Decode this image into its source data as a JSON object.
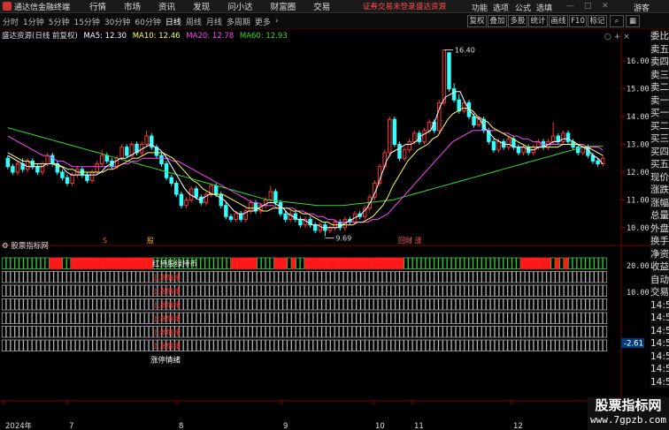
{
  "app": {
    "title": "通达信金融终端",
    "menus": [
      "行情",
      "市场",
      "资讯",
      "发现",
      "问小达",
      "财富圈",
      "交易"
    ],
    "notice": "证券交易未登录",
    "notice2": "盛达资源",
    "right_menus": [
      "功能",
      "选项",
      "公式",
      "选填",
      "游客"
    ]
  },
  "toolbar": {
    "periods": [
      "分时",
      "1分钟",
      "5分钟",
      "15分钟",
      "30分钟",
      "60分钟",
      "日线",
      "周线",
      "月线",
      "多周期",
      "更多"
    ],
    "active_period": "日线",
    "tools": [
      "复权",
      "叠加",
      "多股",
      "统计",
      "画线",
      "F10",
      "标记"
    ]
  },
  "info": {
    "stock": "盛达资源(日线 前复权)",
    "ma5": "MA5: 12.30",
    "ma10": "MA10: 12.46",
    "ma20": "MA20: 12.78",
    "ma60": "MA60: 12.93"
  },
  "colors": {
    "up": "#ff3333",
    "down": "#33ffff",
    "ma5": "#ffffff",
    "ma10": "#ffff66",
    "ma20": "#ff44ff",
    "ma60": "#33dd33",
    "grid": "#550000"
  },
  "chart_data": {
    "type": "candlestick",
    "title": "盛达资源(日线 前复权)",
    "y_ticks": [
      10.0,
      11.0,
      12.0,
      13.0,
      14.0,
      15.0,
      16.0
    ],
    "ylim": [
      9.55,
      16.8
    ],
    "x_labels": [
      "2024年",
      "7",
      "8",
      "9",
      "10",
      "11",
      "12"
    ],
    "max_label": "16.40",
    "min_label": "9.69",
    "event_labels": [
      "S",
      "股",
      "回财 涨"
    ],
    "candles": [
      [
        12.5,
        12.2,
        12.6,
        12.1
      ],
      [
        12.2,
        12.0,
        12.3,
        11.9
      ],
      [
        12.0,
        12.3,
        12.4,
        11.9
      ],
      [
        12.3,
        12.1,
        12.5,
        12.0
      ],
      [
        12.1,
        12.4,
        12.5,
        12.0
      ],
      [
        12.4,
        12.2,
        12.5,
        12.1
      ],
      [
        12.2,
        12.0,
        12.3,
        11.9
      ],
      [
        12.0,
        12.3,
        12.4,
        11.9
      ],
      [
        12.3,
        12.6,
        12.7,
        12.2
      ],
      [
        12.6,
        12.3,
        12.7,
        12.2
      ],
      [
        12.3,
        12.0,
        12.4,
        11.9
      ],
      [
        12.0,
        11.8,
        12.1,
        11.7
      ],
      [
        11.8,
        11.6,
        11.9,
        11.5
      ],
      [
        11.6,
        11.9,
        12.0,
        11.5
      ],
      [
        11.9,
        12.1,
        12.2,
        11.8
      ],
      [
        12.1,
        11.9,
        12.2,
        11.8
      ],
      [
        11.9,
        11.7,
        12.0,
        11.6
      ],
      [
        11.7,
        12.0,
        12.1,
        11.6
      ],
      [
        12.0,
        12.3,
        12.4,
        11.9
      ],
      [
        12.3,
        12.6,
        12.8,
        12.2
      ],
      [
        12.6,
        12.4,
        12.7,
        12.3
      ],
      [
        12.4,
        12.2,
        12.5,
        12.1
      ],
      [
        12.2,
        12.5,
        12.6,
        12.1
      ],
      [
        12.5,
        12.9,
        13.0,
        12.4
      ],
      [
        12.9,
        12.6,
        13.0,
        12.5
      ],
      [
        12.6,
        13.0,
        13.1,
        12.5
      ],
      [
        13.0,
        12.7,
        13.1,
        12.6
      ],
      [
        12.7,
        13.0,
        13.1,
        12.6
      ],
      [
        13.0,
        13.3,
        13.5,
        12.9
      ],
      [
        13.3,
        12.9,
        13.4,
        12.8
      ],
      [
        12.9,
        12.6,
        13.0,
        12.5
      ],
      [
        12.6,
        12.3,
        12.7,
        12.2
      ],
      [
        12.3,
        11.8,
        12.4,
        11.7
      ],
      [
        11.8,
        11.6,
        11.9,
        11.5
      ],
      [
        11.6,
        11.2,
        11.7,
        11.1
      ],
      [
        11.2,
        10.8,
        11.3,
        10.7
      ],
      [
        10.8,
        11.0,
        11.1,
        10.7
      ],
      [
        11.0,
        11.4,
        11.5,
        10.9
      ],
      [
        11.4,
        11.1,
        11.5,
        11.0
      ],
      [
        11.1,
        10.9,
        11.2,
        10.8
      ],
      [
        10.9,
        11.2,
        11.3,
        10.8
      ],
      [
        11.2,
        11.5,
        11.6,
        11.1
      ],
      [
        11.5,
        11.2,
        11.6,
        11.1
      ],
      [
        11.2,
        10.8,
        11.3,
        10.7
      ],
      [
        10.8,
        10.4,
        10.9,
        10.3
      ],
      [
        10.4,
        10.3,
        10.5,
        10.2
      ],
      [
        10.3,
        10.5,
        10.6,
        10.2
      ],
      [
        10.5,
        10.3,
        10.6,
        10.2
      ],
      [
        10.3,
        10.6,
        10.7,
        10.2
      ],
      [
        10.6,
        10.9,
        11.0,
        10.5
      ],
      [
        10.9,
        10.6,
        11.0,
        10.5
      ],
      [
        10.6,
        10.8,
        10.9,
        10.5
      ],
      [
        10.8,
        11.0,
        11.1,
        10.7
      ],
      [
        11.0,
        11.3,
        11.5,
        10.9
      ],
      [
        11.3,
        10.9,
        11.4,
        10.8
      ],
      [
        10.9,
        10.5,
        11.0,
        10.4
      ],
      [
        10.5,
        10.3,
        10.6,
        10.2
      ],
      [
        10.3,
        10.5,
        10.6,
        10.2
      ],
      [
        10.5,
        10.3,
        10.6,
        10.2
      ],
      [
        10.3,
        10.1,
        10.4,
        10.0
      ],
      [
        10.1,
        10.3,
        10.4,
        10.0
      ],
      [
        10.3,
        10.1,
        10.4,
        10.0
      ],
      [
        10.1,
        9.9,
        10.2,
        9.8
      ],
      [
        9.9,
        10.1,
        10.2,
        9.8
      ],
      [
        10.1,
        9.9,
        10.2,
        9.69
      ],
      [
        9.9,
        10.0,
        10.1,
        9.8
      ],
      [
        10.0,
        10.2,
        10.3,
        9.9
      ],
      [
        10.2,
        10.0,
        10.3,
        9.9
      ],
      [
        10.0,
        10.3,
        10.4,
        9.9
      ],
      [
        10.3,
        10.2,
        10.4,
        10.1
      ],
      [
        10.2,
        10.5,
        10.6,
        10.1
      ],
      [
        10.5,
        10.4,
        10.6,
        10.3
      ],
      [
        10.4,
        10.7,
        10.8,
        10.3
      ],
      [
        10.7,
        11.1,
        11.2,
        10.6
      ],
      [
        11.1,
        11.6,
        11.7,
        11.0
      ],
      [
        11.6,
        12.2,
        12.3,
        11.5
      ],
      [
        12.2,
        12.7,
        12.8,
        12.1
      ],
      [
        12.7,
        13.9,
        14.0,
        12.6
      ],
      [
        13.9,
        13.0,
        14.0,
        12.9
      ],
      [
        13.0,
        12.5,
        13.1,
        12.4
      ],
      [
        12.5,
        12.8,
        12.9,
        12.4
      ],
      [
        12.8,
        13.1,
        13.2,
        12.7
      ],
      [
        13.1,
        13.4,
        13.5,
        13.0
      ],
      [
        13.4,
        13.1,
        13.5,
        13.0
      ],
      [
        13.1,
        13.5,
        13.6,
        13.0
      ],
      [
        13.5,
        13.8,
        13.9,
        13.4
      ],
      [
        13.8,
        13.5,
        13.9,
        13.4
      ],
      [
        13.5,
        14.5,
        14.6,
        13.4
      ],
      [
        14.5,
        16.4,
        16.4,
        14.4
      ],
      [
        16.3,
        15.0,
        16.3,
        14.9
      ],
      [
        15.0,
        14.6,
        15.2,
        14.5
      ],
      [
        14.6,
        14.2,
        14.8,
        14.1
      ],
      [
        14.2,
        14.5,
        14.6,
        14.1
      ],
      [
        14.5,
        14.0,
        14.6,
        13.9
      ],
      [
        14.0,
        13.7,
        14.1,
        13.6
      ],
      [
        13.7,
        13.9,
        14.0,
        13.6
      ],
      [
        13.9,
        13.5,
        14.0,
        13.4
      ],
      [
        13.5,
        13.1,
        13.6,
        13.0
      ],
      [
        13.1,
        12.8,
        13.2,
        12.7
      ],
      [
        12.8,
        13.1,
        13.2,
        12.7
      ],
      [
        13.1,
        12.9,
        13.2,
        12.8
      ],
      [
        12.9,
        13.2,
        13.3,
        12.8
      ],
      [
        13.2,
        12.9,
        13.3,
        12.8
      ],
      [
        12.9,
        12.7,
        13.0,
        12.6
      ],
      [
        12.7,
        12.9,
        13.0,
        12.6
      ],
      [
        12.9,
        12.7,
        13.0,
        12.6
      ],
      [
        12.7,
        12.9,
        13.0,
        12.6
      ],
      [
        12.9,
        13.1,
        13.2,
        12.8
      ],
      [
        13.1,
        12.9,
        13.2,
        12.8
      ],
      [
        12.9,
        13.1,
        13.2,
        12.8
      ],
      [
        13.1,
        13.3,
        13.8,
        13.0
      ],
      [
        13.3,
        13.1,
        13.4,
        13.0
      ],
      [
        13.1,
        13.4,
        13.5,
        13.0
      ],
      [
        13.4,
        13.1,
        13.5,
        13.0
      ],
      [
        13.1,
        12.9,
        13.2,
        12.8
      ],
      [
        12.9,
        12.7,
        13.0,
        12.6
      ],
      [
        12.7,
        12.9,
        13.0,
        12.6
      ],
      [
        12.9,
        12.6,
        13.0,
        12.5
      ],
      [
        12.6,
        12.4,
        12.7,
        12.3
      ],
      [
        12.4,
        12.3,
        12.5,
        12.2
      ],
      [
        12.3,
        12.5,
        12.6,
        12.2
      ]
    ],
    "ma5": [
      12.6,
      12.5,
      12.4,
      12.3,
      12.2,
      12.2,
      12.2,
      12.2,
      12.3,
      12.3,
      12.3,
      12.2,
      12.0,
      11.9,
      11.9,
      11.9,
      11.9,
      11.9,
      11.9,
      12.0,
      12.2,
      12.3,
      12.4,
      12.5,
      12.5,
      12.6,
      12.7,
      12.8,
      12.9,
      13.0,
      12.9,
      12.8,
      12.6,
      12.3,
      12.0,
      11.7,
      11.4,
      11.2,
      11.1,
      11.0,
      11.1,
      11.2,
      11.2,
      11.1,
      11.0,
      10.8,
      10.6,
      10.5,
      10.5,
      10.6,
      10.6,
      10.7,
      10.8,
      10.9,
      10.9,
      10.8,
      10.7,
      10.5,
      10.4,
      10.3,
      10.3,
      10.2,
      10.1,
      10.1,
      10.0,
      10.0,
      10.0,
      10.0,
      10.1,
      10.2,
      10.3,
      10.4,
      10.5,
      10.7,
      11.0,
      11.4,
      11.9,
      12.4,
      12.7,
      12.8,
      12.9,
      13.0,
      13.0,
      13.1,
      13.3,
      13.4,
      13.5,
      13.9,
      14.4,
      14.7,
      14.8,
      14.9,
      14.9,
      14.5,
      14.2,
      14.0,
      13.9,
      13.6,
      13.4,
      13.2,
      13.1,
      13.0,
      13.0,
      12.9,
      12.9,
      12.9,
      12.8,
      12.8,
      12.9,
      12.9,
      13.0,
      13.1,
      13.1,
      13.2,
      13.2,
      13.1,
      13.0,
      12.9,
      12.8,
      12.6,
      12.5,
      12.3
    ],
    "ma10": [
      12.7,
      12.6,
      12.5,
      12.4,
      12.4,
      12.3,
      12.3,
      12.3,
      12.3,
      12.3,
      12.2,
      12.2,
      12.1,
      12.1,
      12.0,
      12.0,
      12.0,
      12.0,
      12.0,
      12.0,
      12.1,
      12.1,
      12.2,
      12.3,
      12.4,
      12.5,
      12.5,
      12.6,
      12.7,
      12.7,
      12.7,
      12.7,
      12.6,
      12.5,
      12.3,
      12.1,
      11.9,
      11.7,
      11.6,
      11.4,
      11.3,
      11.2,
      11.2,
      11.2,
      11.1,
      11.0,
      10.9,
      10.8,
      10.7,
      10.7,
      10.7,
      10.6,
      10.6,
      10.7,
      10.7,
      10.7,
      10.7,
      10.6,
      10.6,
      10.5,
      10.5,
      10.4,
      10.3,
      10.2,
      10.2,
      10.1,
      10.1,
      10.1,
      10.1,
      10.1,
      10.2,
      10.2,
      10.3,
      10.4,
      10.6,
      10.8,
      11.1,
      11.5,
      11.8,
      12.1,
      12.4,
      12.6,
      12.8,
      12.9,
      13.0,
      13.2,
      13.3,
      13.6,
      13.9,
      14.1,
      14.2,
      14.3,
      14.3,
      14.2,
      14.0,
      13.9,
      13.8,
      13.6,
      13.5,
      13.4,
      13.3,
      13.2,
      13.1,
      13.0,
      12.9,
      12.9,
      12.9,
      12.9,
      12.9,
      12.9,
      12.9,
      13.0,
      13.0,
      13.0,
      13.0,
      12.9,
      12.9,
      12.8,
      12.7,
      12.6
    ],
    "ma20": [
      13.3,
      13.2,
      13.1,
      13.0,
      12.9,
      12.8,
      12.7,
      12.6,
      12.6,
      12.5,
      12.4,
      12.4,
      12.3,
      12.2,
      12.2,
      12.2,
      12.2,
      12.2,
      12.2,
      12.2,
      12.2,
      12.2,
      12.2,
      12.3,
      12.3,
      12.4,
      12.4,
      12.5,
      12.5,
      12.5,
      12.5,
      12.5,
      12.5,
      12.4,
      12.4,
      12.3,
      12.2,
      12.1,
      12.0,
      11.9,
      11.8,
      11.7,
      11.6,
      11.5,
      11.4,
      11.3,
      11.2,
      11.1,
      11.0,
      10.9,
      10.9,
      10.8,
      10.8,
      10.8,
      10.7,
      10.7,
      10.7,
      10.7,
      10.6,
      10.6,
      10.5,
      10.5,
      10.4,
      10.4,
      10.3,
      10.3,
      10.2,
      10.2,
      10.2,
      10.2,
      10.2,
      10.2,
      10.2,
      10.3,
      10.3,
      10.4,
      10.5,
      10.7,
      10.9,
      11.1,
      11.3,
      11.5,
      11.7,
      11.9,
      12.1,
      12.3,
      12.5,
      12.7,
      12.9,
      13.1,
      13.2,
      13.3,
      13.4,
      13.5,
      13.5,
      13.5,
      13.5,
      13.5,
      13.5,
      13.4,
      13.4,
      13.3,
      13.3,
      13.2,
      13.2,
      13.1,
      13.1,
      13.0,
      13.0,
      13.0,
      13.0,
      13.0,
      13.0,
      13.0,
      13.0,
      13.0,
      12.9,
      12.9,
      12.9,
      12.8
    ],
    "ma60": [
      13.6,
      13.55,
      13.5,
      13.45,
      13.4,
      13.35,
      13.3,
      13.25,
      13.2,
      13.15,
      13.1,
      13.05,
      13.0,
      12.95,
      12.9,
      12.85,
      12.8,
      12.75,
      12.7,
      12.65,
      12.6,
      12.55,
      12.5,
      12.45,
      12.4,
      12.35,
      12.3,
      12.25,
      12.2,
      12.15,
      12.1,
      12.05,
      12.0,
      11.95,
      11.9,
      11.85,
      11.8,
      11.75,
      11.7,
      11.65,
      11.6,
      11.55,
      11.5,
      11.45,
      11.4,
      11.35,
      11.3,
      11.25,
      11.2,
      11.15,
      11.1,
      11.05,
      11.0,
      10.98,
      10.96,
      10.94,
      10.92,
      10.9,
      10.88,
      10.86,
      10.84,
      10.82,
      10.8,
      10.8,
      10.8,
      10.8,
      10.8,
      10.8,
      10.82,
      10.84,
      10.86,
      10.88,
      10.9,
      10.92,
      10.94,
      10.96,
      10.98,
      11.0,
      11.05,
      11.1,
      11.15,
      11.2,
      11.25,
      11.3,
      11.35,
      11.4,
      11.45,
      11.5,
      11.55,
      11.6,
      11.65,
      11.7,
      11.75,
      11.8,
      11.85,
      11.9,
      11.95,
      12.0,
      12.05,
      12.1,
      12.15,
      12.2,
      12.25,
      12.3,
      12.35,
      12.4,
      12.45,
      12.5,
      12.55,
      12.6,
      12.65,
      12.7,
      12.75,
      12.8,
      12.85,
      12.9,
      12.93,
      12.93,
      12.93,
      12.93
    ]
  },
  "indicator": {
    "title": "股票指标网",
    "row1_label": "红持股绿持币",
    "row_labels": [
      "上涨情绪",
      "上涨情绪",
      "上涨情绪",
      "上涨情绪",
      "上涨情绪",
      "上涨情绪"
    ],
    "bottom_label": "涨停情绪",
    "axis_ticks": [
      "20.00",
      "10.00"
    ],
    "value_label": "-2.61",
    "signal": [
      0,
      0,
      0,
      0,
      0,
      0,
      0,
      0,
      0,
      0,
      0,
      1,
      1,
      1,
      0,
      0,
      1,
      1,
      1,
      1,
      1,
      1,
      1,
      1,
      1,
      1,
      1,
      1,
      1,
      1,
      1,
      1,
      1,
      1,
      1,
      0,
      0,
      0,
      0,
      0,
      0,
      0,
      0,
      0,
      0,
      0,
      0,
      0,
      0,
      0,
      0,
      0,
      0,
      1,
      1,
      1,
      1,
      1,
      1,
      0,
      0,
      0,
      0,
      1,
      1,
      1,
      0,
      1,
      0,
      0,
      1,
      1,
      1,
      1,
      1,
      1,
      1,
      1,
      1,
      1,
      1,
      1,
      1,
      1,
      1,
      1,
      1,
      1,
      1,
      1,
      1,
      1,
      1,
      0,
      0,
      0,
      0,
      0,
      0,
      0,
      0,
      0,
      0,
      0,
      0,
      0,
      0,
      0,
      0,
      0,
      0,
      0,
      0,
      0,
      0,
      0,
      0,
      0,
      0,
      0,
      1,
      1,
      1,
      1,
      1,
      1,
      1,
      0,
      1,
      0,
      1,
      0,
      0,
      0,
      0,
      0,
      0,
      0,
      0,
      0
    ]
  },
  "quote_panel": [
    "委比",
    "卖五",
    "卖四",
    "卖三",
    "卖二",
    "卖一",
    "买一",
    "买二",
    "买三",
    "买四",
    "买五",
    "现价",
    "涨跌",
    "涨幅",
    "总量",
    "外盘",
    "换手",
    "净资",
    "收益",
    "自动",
    "交易",
    "14:5",
    "14:5",
    "14:5",
    "14:5",
    "14:5",
    "14:5",
    "14:5"
  ],
  "footer_logo": {
    "line1": "股票指标网",
    "line2": "www.7gpzb.com"
  }
}
